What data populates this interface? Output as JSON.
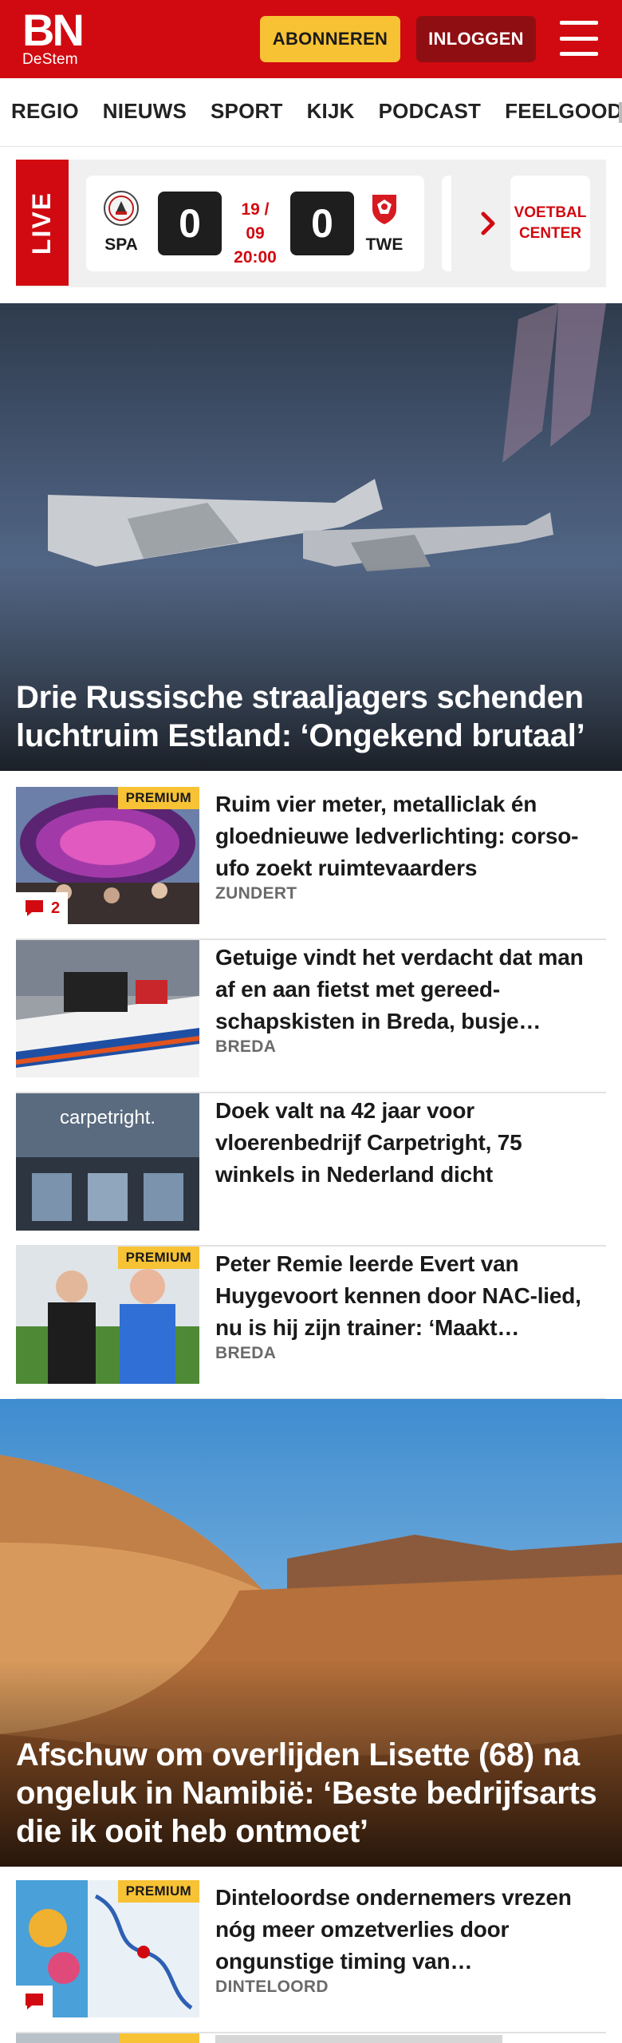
{
  "header": {
    "logo_main": "BN",
    "logo_sub": "DeStem",
    "subscribe_label": "ABONNEREN",
    "login_label": "INLOGGEN",
    "menu_icon": "hamburger-icon",
    "colors": {
      "brand": "#d10a11",
      "subscribe": "#f7c234",
      "login": "#8f0e12"
    }
  },
  "nav": {
    "items": [
      "REGIO",
      "NIEUWS",
      "SPORT",
      "KIJK",
      "PODCAST",
      "FEELGOOD"
    ]
  },
  "live": {
    "label": "LIVE",
    "match": {
      "home_code": "SPA",
      "away_code": "TWE",
      "home_score": "0",
      "away_score": "0",
      "date": "19 / 09",
      "time": "20:00"
    },
    "voetbal_center": "VOETBAL CENTER"
  },
  "hero1": {
    "title": "Drie Russische straaljagers schenden luchtruim Estland: ‘Ongekend brutaal’"
  },
  "articles": [
    {
      "title": "Ruim vier meter, metalliclak én gloednieuwe ledverlichting: corso-ufo zoekt ruimtevaarders",
      "location": "ZUNDERT",
      "premium": "PREMIUM",
      "comments": "2"
    },
    {
      "title": "Getuige vindt het verdacht dat man af en aan fietst met gereed­schapskisten in Breda, busje…",
      "location": "BREDA"
    },
    {
      "title": "Doek valt na 42 jaar voor vloerenbedrijf Carpetright, 75 winkels in Nederland dicht",
      "location": "",
      "thumb_text": "carpetright."
    },
    {
      "title": "Peter Remie leerde Evert van Huygevoort kennen door NAC-lied, nu is hij zijn trainer: ‘Maakt…",
      "location": "BREDA",
      "premium": "PREMIUM"
    }
  ],
  "hero2": {
    "title": "Afschuw om overlijden Lisette (68) na ongeluk in Namibië: ‘Beste bedrijfs­arts die ik ooit heb ontmoet’"
  },
  "articles2": [
    {
      "title": "Dinteloordse ondernemers vrezen nóg meer omzetverlies door ongunstige timing van…",
      "location": "DINTELOORD",
      "premium": "PREMIUM"
    }
  ]
}
